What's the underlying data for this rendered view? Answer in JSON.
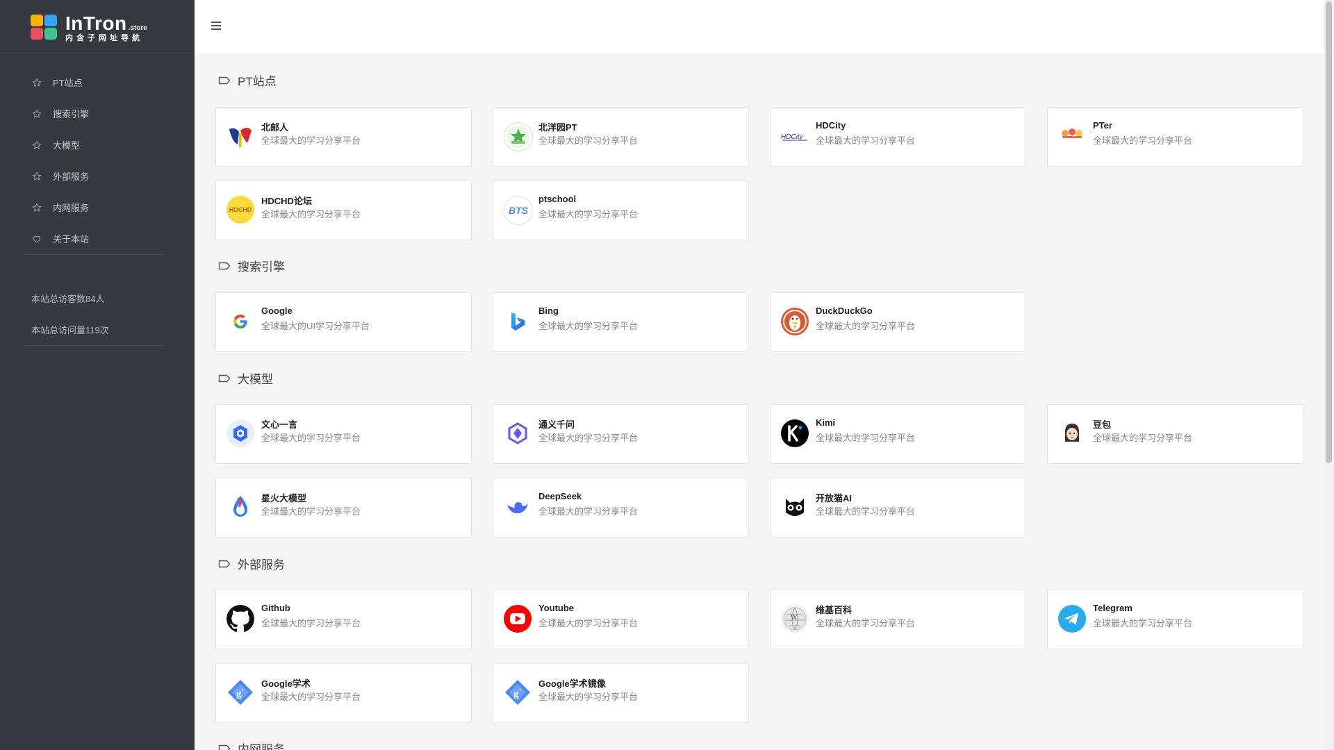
{
  "brand": {
    "name": "InTron",
    "suffix": ".store",
    "subtitle": "内含子网址导航",
    "colors": [
      "#f4b400",
      "#36a3f7",
      "#e8505b",
      "#3cc48f"
    ]
  },
  "sidebar": {
    "items": [
      {
        "label": "PT站点",
        "icon": "star-icon"
      },
      {
        "label": "搜索引擎",
        "icon": "star-icon"
      },
      {
        "label": "大模型",
        "icon": "star-icon"
      },
      {
        "label": "外部服务",
        "icon": "star-icon"
      },
      {
        "label": "内网服务",
        "icon": "star-icon"
      },
      {
        "label": "关于本站",
        "icon": "heart-icon"
      }
    ],
    "stats": [
      "本站总访客数84人",
      "本站总访问量119次"
    ]
  },
  "sections": [
    {
      "title": "PT站点",
      "cards": [
        {
          "name": "北邮人",
          "desc": "全球最大的学习分享平台",
          "icon": "byr-logo"
        },
        {
          "name": "北洋园PT",
          "desc": "全球最大的学习分享平台",
          "icon": "tjupt-logo"
        },
        {
          "name": "HDCity",
          "desc": "全球最大的学习分享平台",
          "icon": "hdcity-logo"
        },
        {
          "name": "PTer",
          "desc": "全球最大的学习分享平台",
          "icon": "pter-logo"
        },
        {
          "name": "HDCHD论坛",
          "desc": "全球最大的学习分享平台",
          "icon": "hdchd-logo",
          "badge": "HDCHD"
        },
        {
          "name": "ptschool",
          "desc": "全球最大的学习分享平台",
          "icon": "ptschool-logo",
          "badge": "BTS"
        }
      ]
    },
    {
      "title": "搜索引擎",
      "cards": [
        {
          "name": "Google",
          "desc": "全球最大的UI学习分享平台",
          "icon": "google-logo"
        },
        {
          "name": "Bing",
          "desc": "全球最大的学习分享平台",
          "icon": "bing-logo"
        },
        {
          "name": "DuckDuckGo",
          "desc": "全球最大的学习分享平台",
          "icon": "duckduckgo-logo"
        }
      ]
    },
    {
      "title": "大模型",
      "cards": [
        {
          "name": "文心一言",
          "desc": "全球最大的学习分享平台",
          "icon": "wenxin-logo"
        },
        {
          "name": "通义千问",
          "desc": "全球最大的学习分享平台",
          "icon": "tongyi-logo"
        },
        {
          "name": "Kimi",
          "desc": "全球最大的学习分享平台",
          "icon": "kimi-logo"
        },
        {
          "name": "豆包",
          "desc": "全球最大的学习分享平台",
          "icon": "doubao-logo"
        },
        {
          "name": "星火大模型",
          "desc": "全球最大的学习分享平台",
          "icon": "xinghuo-logo"
        },
        {
          "name": "DeepSeek",
          "desc": "全球最大的学习分享平台",
          "icon": "deepseek-logo"
        },
        {
          "name": "开放猫AI",
          "desc": "全球最大的学习分享平台",
          "icon": "openmao-logo"
        }
      ]
    },
    {
      "title": "外部服务",
      "cards": [
        {
          "name": "Github",
          "desc": "全球最大的学习分享平台",
          "icon": "github-logo"
        },
        {
          "name": "Youtube",
          "desc": "全球最大的学习分享平台",
          "icon": "youtube-logo"
        },
        {
          "name": "维基百科",
          "desc": "全球最大的学习分享平台",
          "icon": "wikipedia-logo"
        },
        {
          "name": "Telegram",
          "desc": "全球最大的学习分享平台",
          "icon": "telegram-logo"
        },
        {
          "name": "Google学术",
          "desc": "全球最大的学习分享平台",
          "icon": "google-scholar-logo"
        },
        {
          "name": "Google学术镜像",
          "desc": "全球最大的学习分享平台",
          "icon": "google-scholar-mirror-logo"
        }
      ]
    },
    {
      "title": "内网服务",
      "cards": []
    }
  ]
}
